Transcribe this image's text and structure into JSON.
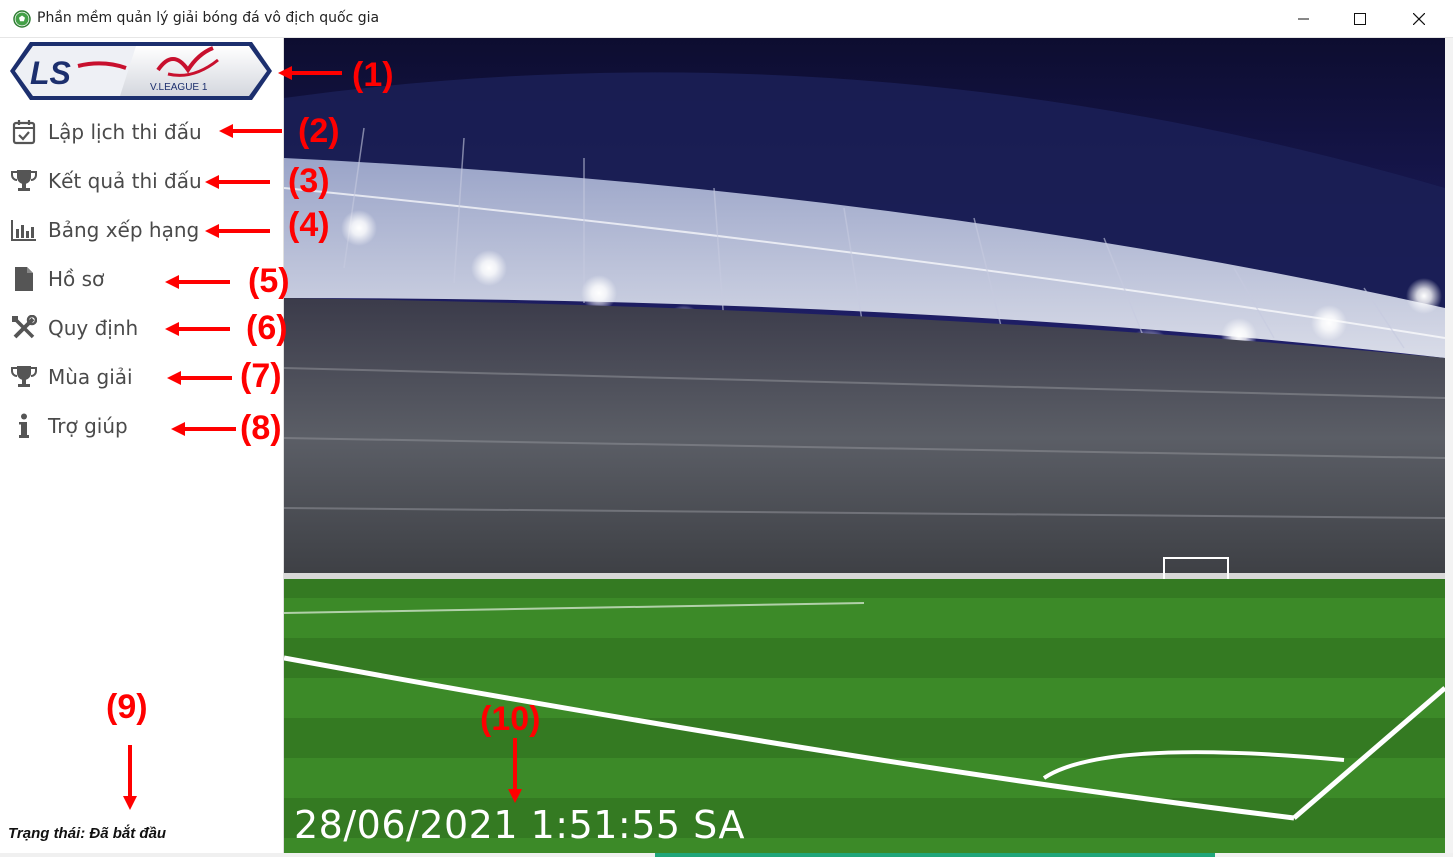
{
  "window": {
    "title": "Phần mềm quản lý giải bóng đá vô địch quốc gia",
    "app_icon": "soccer-ball-icon",
    "controls": [
      "minimize-icon",
      "maximize-icon",
      "close-icon"
    ]
  },
  "logo": {
    "left_text": "LS",
    "right_text": "V.LEAGUE 1"
  },
  "menu": [
    {
      "label": "Lập lịch thi đấu",
      "icon": "calendar-check-icon"
    },
    {
      "label": "Kết quả thi đấu",
      "icon": "trophy-icon"
    },
    {
      "label": "Bảng xếp hạng",
      "icon": "bar-chart-icon"
    },
    {
      "label": "Hồ sơ",
      "icon": "document-icon"
    },
    {
      "label": "Quy định",
      "icon": "tools-icon"
    },
    {
      "label": "Mùa giải",
      "icon": "trophy-icon"
    },
    {
      "label": "Trợ giúp",
      "icon": "info-icon"
    }
  ],
  "status": "Trạng thái: Đã bắt đầu",
  "clock": "28/06/2021 1:51:55 SA",
  "annotations": [
    "(1)",
    "(2)",
    "(3)",
    "(4)",
    "(5)",
    "(6)",
    "(7)",
    "(8)",
    "(9)",
    "(10)"
  ],
  "colors": {
    "annotation": "#ff0000",
    "menu_text": "#4a4a4a",
    "progress": "#1fa67a",
    "logo_blue": "#1c2f6e",
    "logo_red": "#c8102e"
  }
}
